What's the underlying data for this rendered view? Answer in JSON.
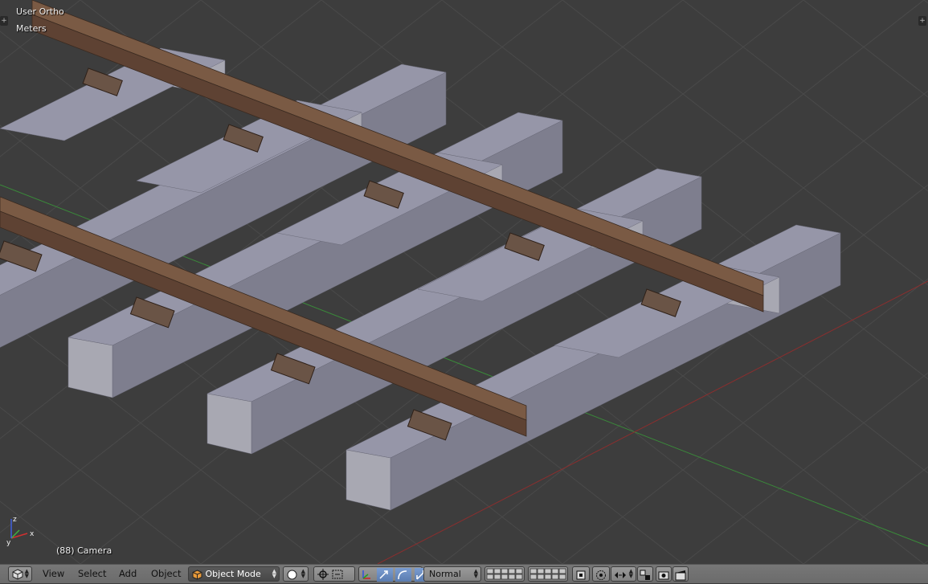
{
  "viewport": {
    "view_name": "User Ortho",
    "units": "Meters",
    "object_info": "(88) Camera",
    "axis_widget": {
      "x": "x",
      "y": "y",
      "z": "z"
    },
    "colors": {
      "background": "#3d3d3d",
      "grid": "#4a4a4a",
      "x_axis": "#8b2e2e",
      "y_axis": "#3a8a3a",
      "sleeper_top": "#9696a8",
      "sleeper_side": "#7e7e8e",
      "sleeper_end": "#a8a8b2",
      "rail_top": "#7a5a44",
      "rail_side": "#5e4233",
      "plate": "#6a5446"
    }
  },
  "header": {
    "editor_type_icon": "3d-view-icon",
    "menus": [
      "View",
      "Select",
      "Add",
      "Object"
    ],
    "mode": {
      "label": "Object Mode",
      "icon": "cube-icon"
    },
    "viewport_shading_icon": "solid-sphere-icon",
    "pivot_icon": "pivot-point-icon",
    "manipulator_icons": [
      "manipulator-toggle-icon",
      "translate-icon",
      "rotate-icon",
      "scale-icon"
    ],
    "orientation": {
      "label": "Normal"
    },
    "layers_icon": "layers-grid-icon",
    "right_icons": [
      "lock-layers-icon",
      "proportional-edit-icon",
      "snap-icon",
      "snap-target-icon",
      "render-icon",
      "clapper-icon"
    ]
  }
}
